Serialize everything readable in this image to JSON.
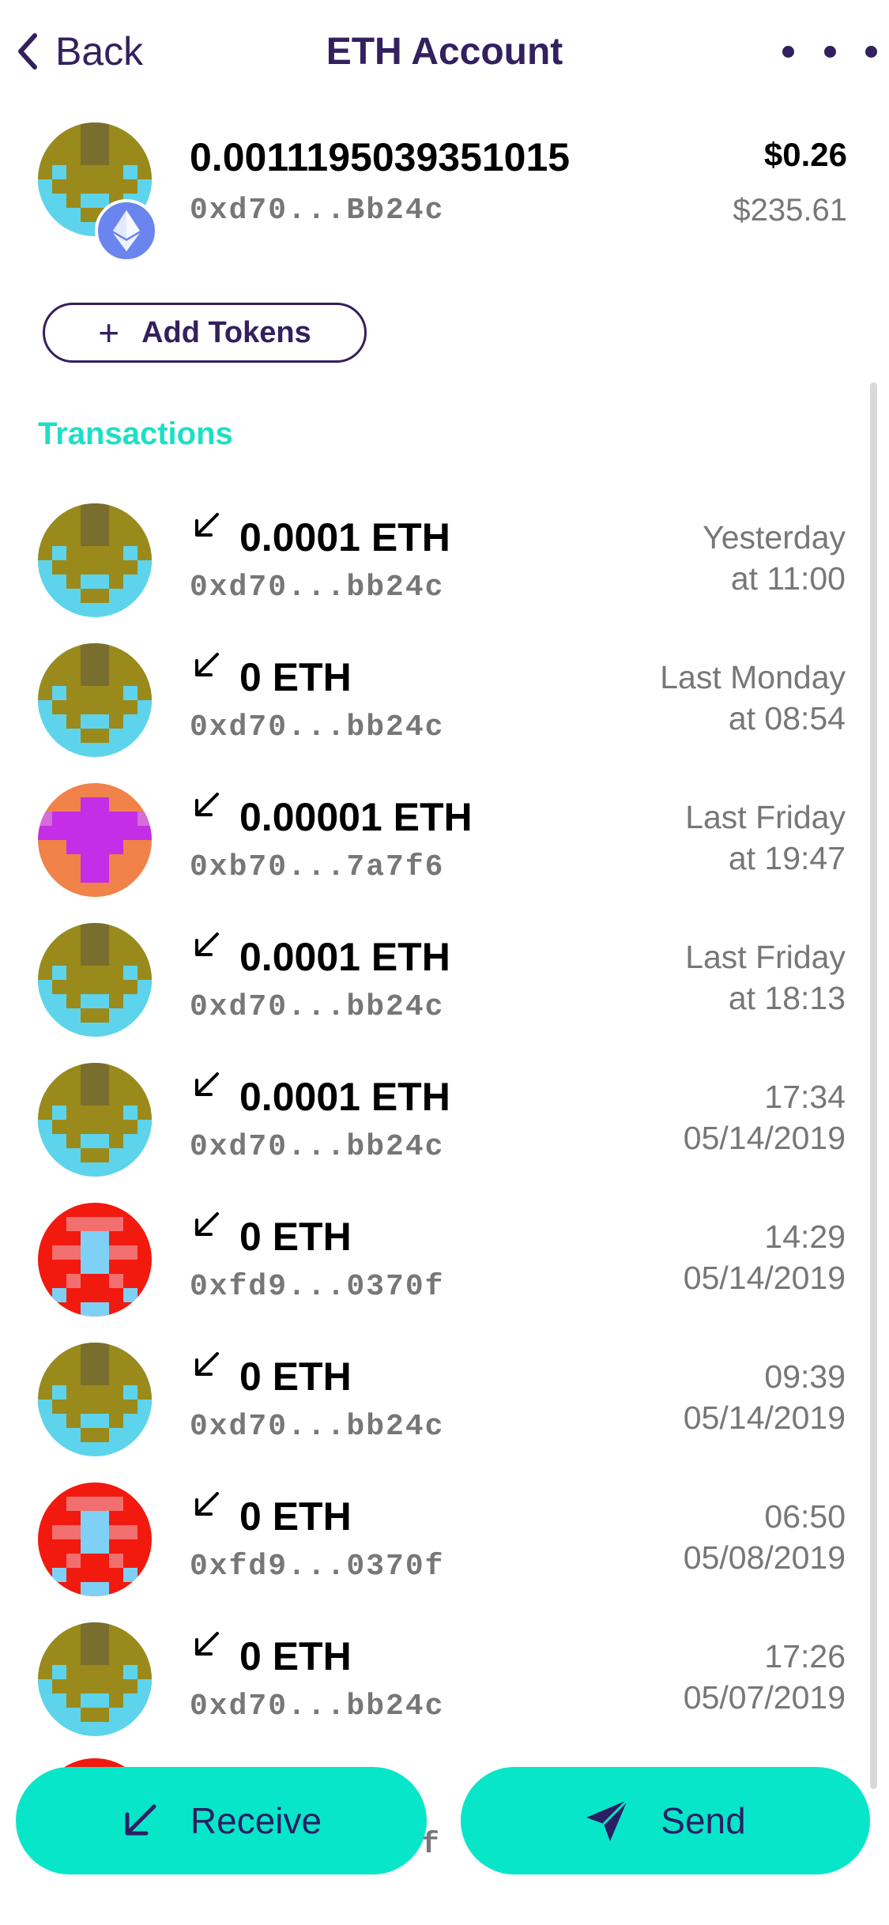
{
  "nav": {
    "back_label": "Back",
    "title": "ETH Account",
    "more_icon": "more-horizontal-icon"
  },
  "account": {
    "balance": "0.0011195039351015",
    "address": "0xd70...Bb24c",
    "usd_value": "$0.26",
    "eth_price": "$235.61",
    "badge_icon": "ethereum-icon"
  },
  "add_tokens": {
    "label": "Add Tokens",
    "icon": "plus-icon"
  },
  "section": {
    "title": "Transactions"
  },
  "transactions": [
    {
      "amount": "0.0001 ETH",
      "address": "0xd70...bb24c",
      "date_line1": "Yesterday",
      "date_line2": "at 11:00",
      "avatar": "olive"
    },
    {
      "amount": "0 ETH",
      "address": "0xd70...bb24c",
      "date_line1": "Last Monday",
      "date_line2": "at 08:54",
      "avatar": "olive"
    },
    {
      "amount": "0.00001 ETH",
      "address": "0xb70...7a7f6",
      "date_line1": "Last Friday",
      "date_line2": "at 19:47",
      "avatar": "purple"
    },
    {
      "amount": "0.0001 ETH",
      "address": "0xd70...bb24c",
      "date_line1": "Last Friday",
      "date_line2": "at 18:13",
      "avatar": "olive"
    },
    {
      "amount": "0.0001 ETH",
      "address": "0xd70...bb24c",
      "date_line1": "17:34",
      "date_line2": "05/14/2019",
      "avatar": "olive"
    },
    {
      "amount": "0 ETH",
      "address": "0xfd9...0370f",
      "date_line1": "14:29",
      "date_line2": "05/14/2019",
      "avatar": "red"
    },
    {
      "amount": "0 ETH",
      "address": "0xd70...bb24c",
      "date_line1": "09:39",
      "date_line2": "05/14/2019",
      "avatar": "olive"
    },
    {
      "amount": "0 ETH",
      "address": "0xfd9...0370f",
      "date_line1": "06:50",
      "date_line2": "05/08/2019",
      "avatar": "red"
    },
    {
      "amount": "0 ETH",
      "address": "0xd70...bb24c",
      "date_line1": "17:26",
      "date_line2": "05/07/2019",
      "avatar": "olive"
    }
  ],
  "bottom": {
    "receive_label": "Receive",
    "send_label": "Send",
    "partial_addr_suffix": "f"
  },
  "colors": {
    "accent": "#08e6c9",
    "heading": "#33205e",
    "section": "#1ddfc6"
  }
}
